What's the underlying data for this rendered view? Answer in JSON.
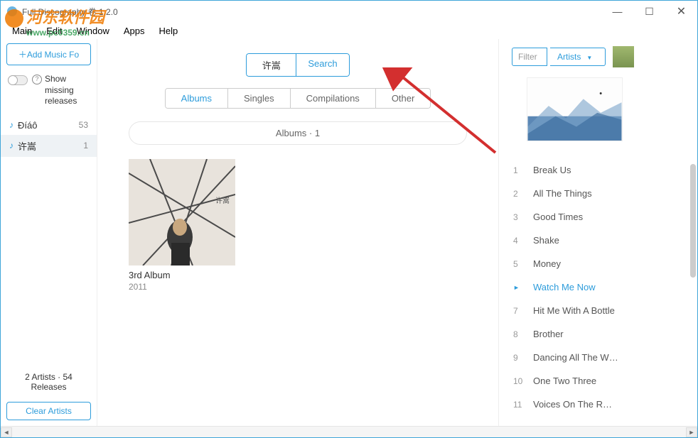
{
  "window": {
    "title": "Full Discography 卷 1.2.0",
    "min": "—",
    "max": "☐",
    "close": "✕"
  },
  "menu": [
    "Main",
    "Edit",
    "Window",
    "Apps",
    "Help"
  ],
  "watermark": {
    "text1": "河东软件园",
    "text2": "www.pc0359.cn"
  },
  "sidebar": {
    "add_label": "＋Add Music Fo",
    "show_label": "Show missing releases",
    "artists": [
      {
        "name": "Đíáô",
        "count": "53"
      },
      {
        "name": "许嵩",
        "count": "1"
      }
    ],
    "footer": "2 Artists · 54 Releases",
    "clear": "Clear Artists"
  },
  "main": {
    "search_value": "许嵩",
    "search_btn": "Search",
    "tabs": [
      "Albums",
      "Singles",
      "Compilations",
      "Other"
    ],
    "section": "Albums · 1",
    "album": {
      "title": "3rd Album",
      "year": "2011"
    }
  },
  "right": {
    "filter_placeholder": "Filter",
    "filter_select": "Artists",
    "tracks": [
      {
        "n": "1",
        "name": "Break Us"
      },
      {
        "n": "2",
        "name": "All The Things"
      },
      {
        "n": "3",
        "name": "Good Times"
      },
      {
        "n": "4",
        "name": "Shake"
      },
      {
        "n": "5",
        "name": "Money"
      },
      {
        "n": "►",
        "name": "Watch Me Now",
        "playing": true
      },
      {
        "n": "7",
        "name": "Hit Me With A Bottle"
      },
      {
        "n": "8",
        "name": "Brother"
      },
      {
        "n": "9",
        "name": "Dancing All The W…"
      },
      {
        "n": "10",
        "name": "One Two Three"
      },
      {
        "n": "11",
        "name": "Voices On The R…"
      }
    ]
  }
}
